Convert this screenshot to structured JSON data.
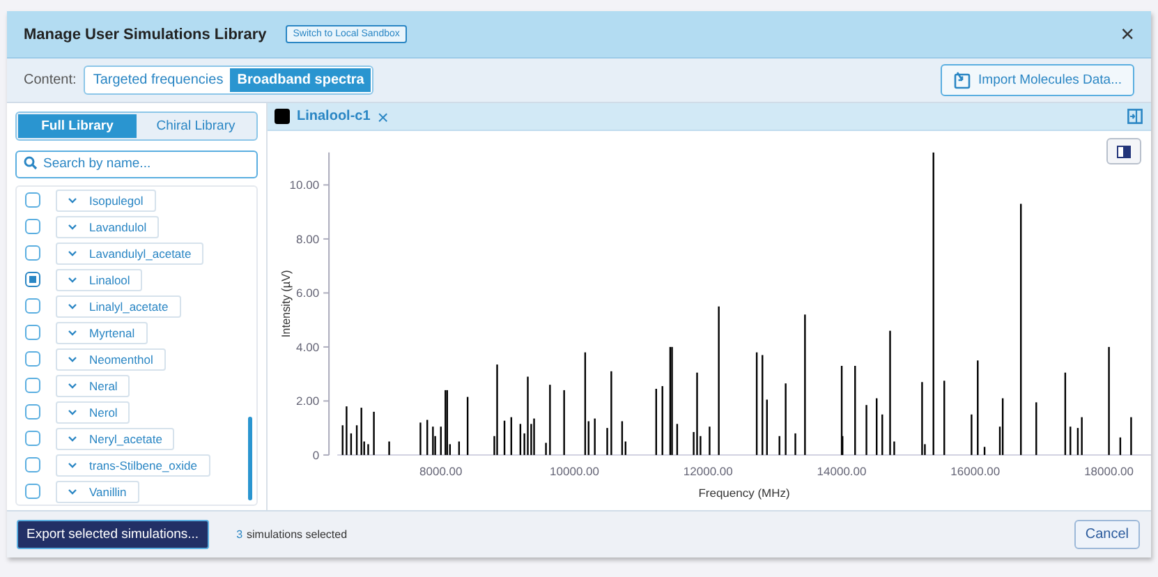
{
  "window": {
    "title": "Manage User Simulations Library",
    "sandbox_button": "Switch to Local Sandbox",
    "close": "×"
  },
  "content_bar": {
    "label": "Content:",
    "options": [
      {
        "label": "Targeted frequencies",
        "selected": false
      },
      {
        "label": "Broadband spectra",
        "selected": true
      }
    ],
    "import_button": "Import Molecules Data..."
  },
  "library_tabs": [
    {
      "label": "Full Library",
      "selected": true
    },
    {
      "label": "Chiral Library",
      "selected": false
    }
  ],
  "search": {
    "placeholder": "Search by name..."
  },
  "molecules": [
    {
      "name": "Isopulegol",
      "checked": false
    },
    {
      "name": "Lavandulol",
      "checked": false
    },
    {
      "name": "Lavandulyl_acetate",
      "checked": false
    },
    {
      "name": "Linalool",
      "checked": true
    },
    {
      "name": "Linalyl_acetate",
      "checked": false
    },
    {
      "name": "Myrtenal",
      "checked": false
    },
    {
      "name": "Neomenthol",
      "checked": false
    },
    {
      "name": "Neral",
      "checked": false
    },
    {
      "name": "Nerol",
      "checked": false
    },
    {
      "name": "Neryl_acetate",
      "checked": false
    },
    {
      "name": "trans-Stilbene_oxide",
      "checked": false
    },
    {
      "name": "Vanillin",
      "checked": false
    }
  ],
  "spectrum_tab": {
    "label": "Linalool-c1",
    "color": "#000000",
    "close": "×"
  },
  "chart_data": {
    "type": "bar",
    "xlabel": "Frequency (MHz)",
    "ylabel": "Intensity (µV)",
    "xlim": [
      6450,
      18630
    ],
    "ylim": [
      0,
      11.2
    ],
    "xticks": [
      {
        "value": 8000,
        "label": "8000.00"
      },
      {
        "value": 10000,
        "label": "10000.00"
      },
      {
        "value": 12000,
        "label": "12000.00"
      },
      {
        "value": 14000,
        "label": "14000.00"
      },
      {
        "value": 16000,
        "label": "16000.00"
      },
      {
        "value": 18000,
        "label": "18000.00"
      }
    ],
    "yticks": [
      {
        "value": 0,
        "label": "0"
      },
      {
        "value": 2,
        "label": "2.00"
      },
      {
        "value": 4,
        "label": "4.00"
      },
      {
        "value": 6,
        "label": "6.00"
      },
      {
        "value": 8,
        "label": "8.00"
      },
      {
        "value": 10,
        "label": "10.00"
      }
    ],
    "x": [
      6529,
      6588,
      6656,
      6741,
      6810,
      6852,
      6912,
      6997,
      7226,
      7694,
      7796,
      7881,
      7915,
      8000,
      8068,
      8094,
      8136,
      8272,
      8400,
      8800,
      8842,
      8952,
      9054,
      9190,
      9250,
      9301,
      9352,
      9395,
      9573,
      9633,
      9845,
      10160,
      10211,
      10304,
      10490,
      10551,
      10713,
      10764,
      11223,
      11316,
      11433,
      11460,
      11537,
      11784,
      11835,
      11886,
      12022,
      12160,
      12728,
      12813,
      12881,
      13068,
      13161,
      13306,
      13450,
      14000,
      14012,
      14200,
      14370,
      14523,
      14607,
      14724,
      14786,
      15203,
      15245,
      15373,
      15535,
      15943,
      16036,
      16138,
      16367,
      16410,
      16682,
      16912,
      17346,
      17423,
      17534,
      17594,
      18000,
      18170,
      18332
    ],
    "series": [
      {
        "color": "#000000",
        "values": [
          1.1,
          1.8,
          0.8,
          1.1,
          1.75,
          0.5,
          0.4,
          1.6,
          0.5,
          1.2,
          1.3,
          1.05,
          0.7,
          1.05,
          2.4,
          2.4,
          0.4,
          0.5,
          2.15,
          0.7,
          3.35,
          1.27,
          1.4,
          1.15,
          0.8,
          2.9,
          1.15,
          1.35,
          0.45,
          2.6,
          2.4,
          3.8,
          1.25,
          1.35,
          1.0,
          3.1,
          1.25,
          0.5,
          2.45,
          2.55,
          4.0,
          4.0,
          1.15,
          0.85,
          3.05,
          0.7,
          1.05,
          5.5,
          3.8,
          3.7,
          2.05,
          0.7,
          2.65,
          0.8,
          5.2,
          3.3,
          0.7,
          3.3,
          1.85,
          2.1,
          1.5,
          4.6,
          0.5,
          2.7,
          0.4,
          11.2,
          2.75,
          1.5,
          3.5,
          0.3,
          1.05,
          2.1,
          9.3,
          1.95,
          3.05,
          1.05,
          1.0,
          1.4,
          4.0,
          0.65,
          1.4
        ]
      }
    ]
  },
  "footer": {
    "export_button": "Export selected simulations...",
    "selection_count": "3",
    "selection_text": "simulations selected",
    "cancel_button": "Cancel"
  }
}
